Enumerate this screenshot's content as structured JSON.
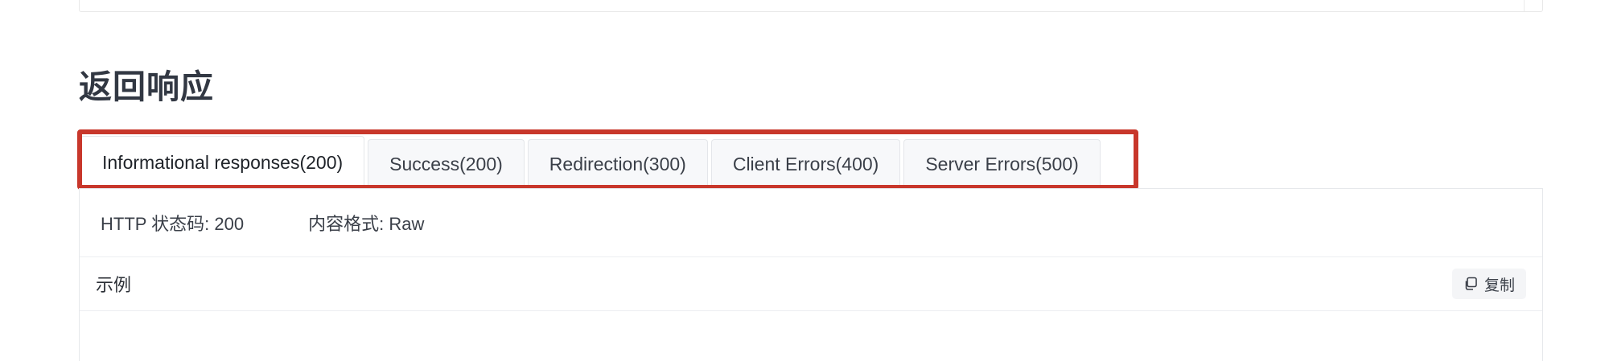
{
  "section": {
    "title": "返回响应"
  },
  "tabs": [
    {
      "label": "Informational responses(200)",
      "active": true
    },
    {
      "label": "Success(200)",
      "active": false
    },
    {
      "label": "Redirection(300)",
      "active": false
    },
    {
      "label": "Client Errors(400)",
      "active": false
    },
    {
      "label": "Server Errors(500)",
      "active": false
    }
  ],
  "response": {
    "status_text": "HTTP 状态码: 200",
    "format_text": "内容格式: Raw"
  },
  "example": {
    "label": "示例",
    "copy_label": "复制",
    "copy_icon": "copy-icon"
  },
  "colors": {
    "highlight": "#c8372b",
    "tab_bg": "#f7f8fa",
    "active_tab_bg": "#ffffff"
  }
}
